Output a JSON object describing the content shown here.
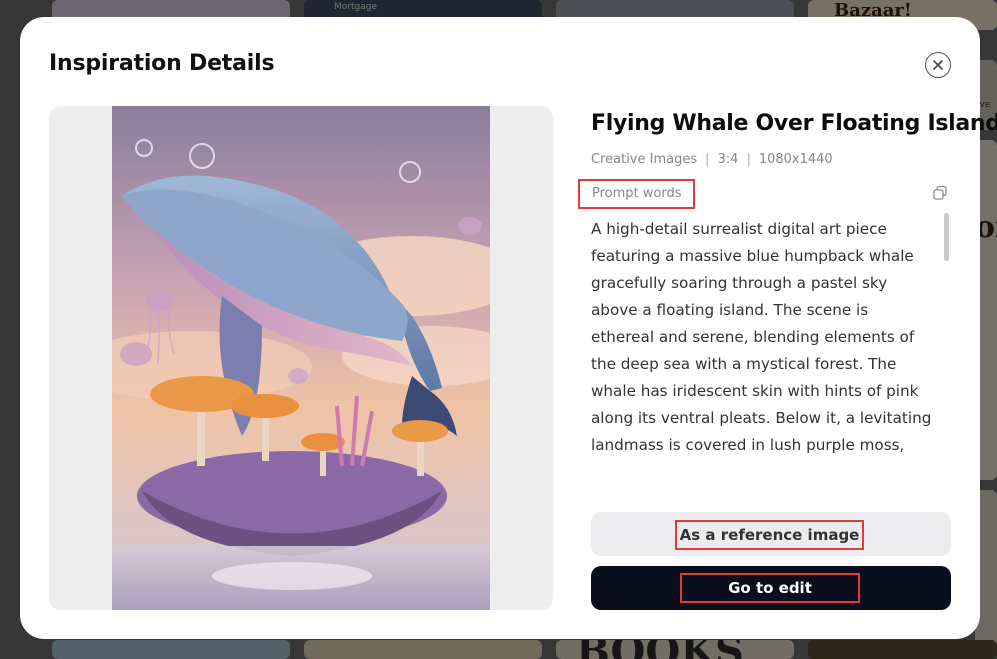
{
  "background": {
    "tile_texts": [
      "Bazaar!",
      "Mortgage",
      "BOOKS",
      "ive",
      "or"
    ]
  },
  "modal": {
    "title": "Inspiration Details",
    "close_icon": "close-icon"
  },
  "preview": {
    "image_description_icon": "whale-artwork"
  },
  "detail": {
    "title": "Flying Whale Over Floating Island",
    "category": "Creative Images",
    "ratio": "3:4",
    "resolution": "1080x1440",
    "separator": "|",
    "prompt_label": "Prompt words",
    "copy_icon": "copy-icon",
    "prompt_text": "A high-detail surrealist digital art piece featuring a massive blue humpback whale gracefully soaring through a pastel sky above a floating island. The scene is ethereal and serene, blending elements of the deep sea with a mystical forest. The whale has iridescent skin with hints of pink along its ventral pleats. Below it, a levitating landmass is covered in lush purple moss,"
  },
  "actions": {
    "reference_label": "As a reference image",
    "edit_label": "Go to edit"
  },
  "colors": {
    "highlight": "#e03a3a",
    "primary_button": "#0a0d1c",
    "secondary_button": "#ececee"
  }
}
